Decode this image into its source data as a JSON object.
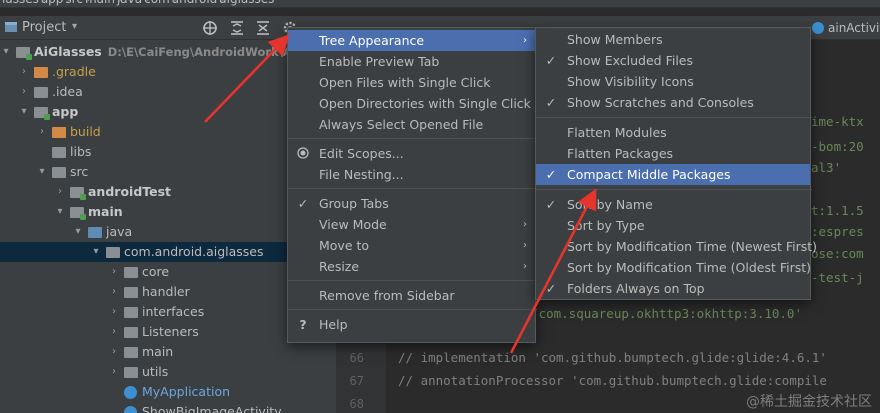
{
  "breadcrumb": [
    "lasses",
    "app",
    "src",
    "main",
    "java",
    "com",
    "android",
    "aiglasses"
  ],
  "project_panel": {
    "title": "Project",
    "icons": [
      "globe-icon",
      "expand-all-icon",
      "collapse-all-icon",
      "settings-icon"
    ]
  },
  "tree": [
    {
      "label": "AiGlasses",
      "path": "D:\\E\\CaiFeng\\AndroidWork\\AiGla",
      "depth": 0,
      "chevron": "down",
      "icon": "module",
      "style": "bold"
    },
    {
      "label": ".gradle",
      "depth": 1,
      "chevron": "right",
      "icon": "orange-folder",
      "style": "orange"
    },
    {
      "label": ".idea",
      "depth": 1,
      "chevron": "right",
      "icon": "folder",
      "style": ""
    },
    {
      "label": "app",
      "depth": 1,
      "chevron": "down",
      "icon": "module",
      "style": "bold"
    },
    {
      "label": "build",
      "depth": 2,
      "chevron": "right",
      "icon": "orange-folder",
      "style": "orange"
    },
    {
      "label": "libs",
      "depth": 2,
      "chevron": "",
      "icon": "folder",
      "style": ""
    },
    {
      "label": "src",
      "depth": 2,
      "chevron": "down",
      "icon": "folder",
      "style": ""
    },
    {
      "label": "androidTest",
      "depth": 3,
      "chevron": "right",
      "icon": "module",
      "style": "bold"
    },
    {
      "label": "main",
      "depth": 3,
      "chevron": "down",
      "icon": "module",
      "style": "bold"
    },
    {
      "label": "java",
      "depth": 4,
      "chevron": "down",
      "icon": "blue-folder",
      "style": ""
    },
    {
      "label": "com.android.aiglasses",
      "depth": 5,
      "chevron": "down",
      "icon": "folder",
      "style": "",
      "selected": true
    },
    {
      "label": "core",
      "depth": 6,
      "chevron": "right",
      "icon": "folder",
      "style": ""
    },
    {
      "label": "handler",
      "depth": 6,
      "chevron": "right",
      "icon": "folder",
      "style": ""
    },
    {
      "label": "interfaces",
      "depth": 6,
      "chevron": "right",
      "icon": "folder",
      "style": ""
    },
    {
      "label": "Listeners",
      "depth": 6,
      "chevron": "right",
      "icon": "folder",
      "style": ""
    },
    {
      "label": "main",
      "depth": 6,
      "chevron": "right",
      "icon": "folder",
      "style": ""
    },
    {
      "label": "utils",
      "depth": 6,
      "chevron": "right",
      "icon": "folder",
      "style": ""
    },
    {
      "label": "MyApplication",
      "depth": 6,
      "chevron": "",
      "icon": "class",
      "style": "blue"
    },
    {
      "label": "ShowBigImageActivity",
      "depth": 6,
      "chevron": "",
      "icon": "class",
      "style": ""
    }
  ],
  "editor": {
    "tabs": [
      {
        "label": "ainActivity"
      }
    ],
    "fragments": [
      "ime-ktx",
      "-bom:20",
      "al3'",
      "t:1.1.5",
      ":espres",
      "ose:com",
      "-test-j"
    ],
    "lines": [
      {
        "num": "",
        "code": "n 'com.squareup.okhttp3:okhttp:3.10.0'"
      },
      {
        "num": "66",
        "code": "//    implementation 'com.github.bumptech.glide:glide:4.6.1'"
      },
      {
        "num": "67",
        "code": "//    annotationProcessor 'com.github.bumptech.glide:compile"
      },
      {
        "num": "68",
        "code": ""
      }
    ]
  },
  "context_menu": [
    {
      "label": "Tree Appearance",
      "submenu": true,
      "highlighted": true
    },
    {
      "label": "Enable Preview Tab"
    },
    {
      "label": "Open Files with Single Click"
    },
    {
      "label": "Open Directories with Single Click"
    },
    {
      "label": "Always Select Opened File"
    },
    {
      "separator": true
    },
    {
      "label": "Edit Scopes...",
      "icon": "radio-icon"
    },
    {
      "label": "File Nesting..."
    },
    {
      "separator": true
    },
    {
      "label": "Group Tabs",
      "checked": true
    },
    {
      "label": "View Mode",
      "submenu": true
    },
    {
      "label": "Move to",
      "submenu": true
    },
    {
      "label": "Resize",
      "submenu": true
    },
    {
      "separator": true
    },
    {
      "label": "Remove from Sidebar"
    },
    {
      "separator": true
    },
    {
      "label": "Help",
      "icon": "help-icon"
    }
  ],
  "submenu": [
    {
      "label": "Show Members"
    },
    {
      "label": "Show Excluded Files",
      "checked": true
    },
    {
      "label": "Show Visibility Icons"
    },
    {
      "label": "Show Scratches and Consoles",
      "checked": true
    },
    {
      "separator": true
    },
    {
      "label": "Flatten Modules"
    },
    {
      "label": "Flatten Packages"
    },
    {
      "label": "Compact Middle Packages",
      "checked": true,
      "highlighted": true
    },
    {
      "separator": true
    },
    {
      "label": "Sort by Name",
      "checked": true
    },
    {
      "label": "Sort by Type"
    },
    {
      "label": "Sort by Modification Time (Newest First)"
    },
    {
      "label": "Sort by Modification Time (Oldest First)"
    },
    {
      "label": "Folders Always on Top",
      "checked": true
    }
  ],
  "watermark": "@稀土掘金技术社区",
  "colors": {
    "accent": "#4b6eaf",
    "annotation": "#e5342c",
    "selection": "#0d293e"
  }
}
